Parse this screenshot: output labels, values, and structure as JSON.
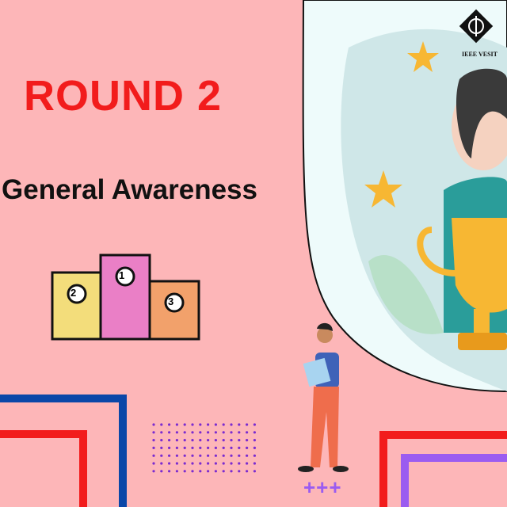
{
  "poster": {
    "title": "ROUND 2",
    "subtitle": "General Awareness",
    "logo_text": "IEEE VESIT",
    "podium_numbers": [
      "2",
      "1",
      "3"
    ],
    "plus_marks": "+++"
  },
  "colors": {
    "background": "#fdb6b8",
    "title": "#f21c1c",
    "blue_frame": "#0a47a8",
    "red_frame": "#f21c1c",
    "purple_frame": "#9b5cf0",
    "dots": "#7b2cd0"
  }
}
